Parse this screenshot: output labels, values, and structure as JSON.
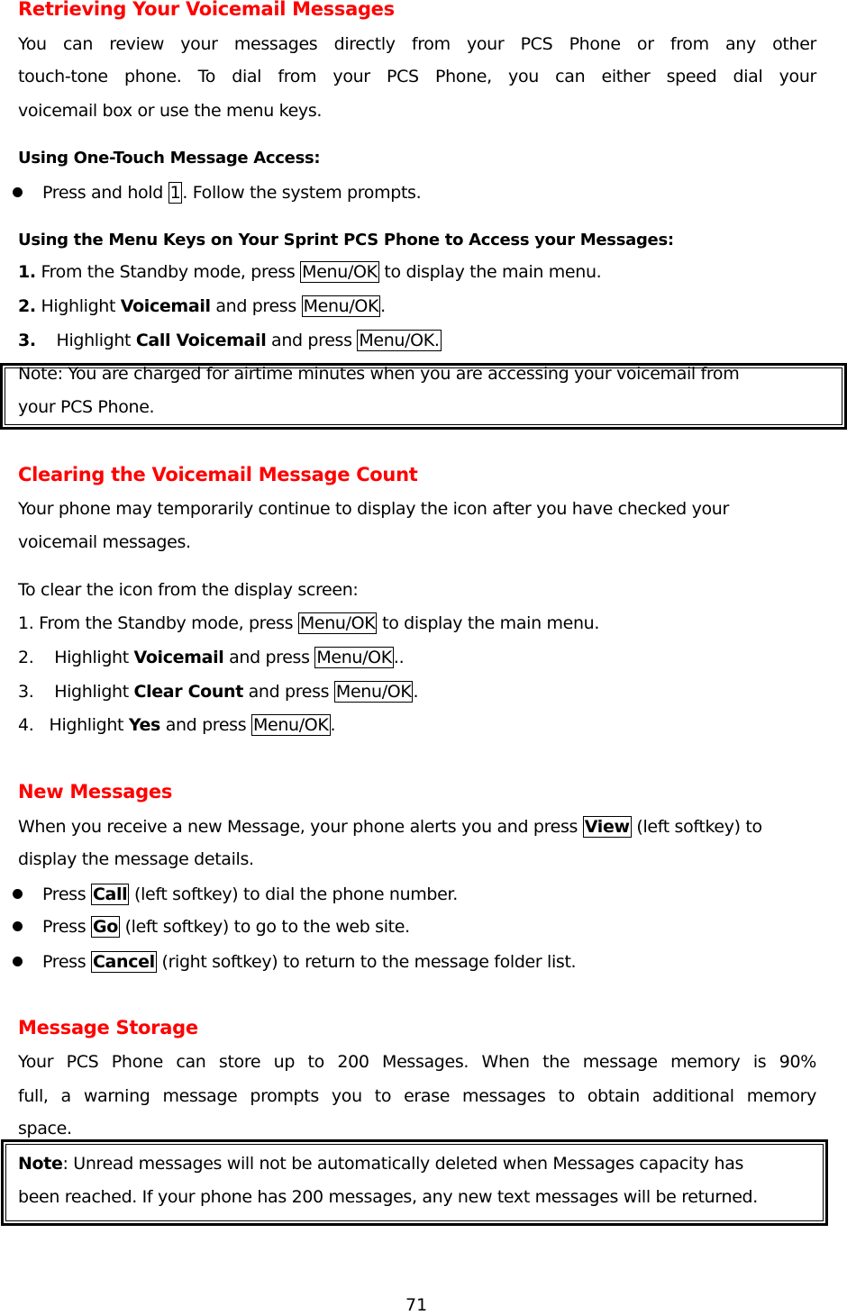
{
  "sections": {
    "retrieving": {
      "heading": "Retrieving Your Voicemail Messages",
      "intro_lines": [
        "You can review your messages directly from your PCS Phone or from any other",
        "touch-tone phone. To dial from your PCS Phone, you can either speed dial your",
        "voicemail box or use the menu keys."
      ],
      "one_touch_heading": "Using One-Touch Message Access:",
      "one_touch_bullet": {
        "prefix": "Press and hold ",
        "key": " 1",
        "suffix": ". Follow the system prompts."
      },
      "menu_keys_heading": "Using the Menu Keys on Your Sprint PCS Phone to Access your Messages:",
      "steps": [
        {
          "num": "1.",
          "pre": " From the Standby mode, press ",
          "bold": "",
          "mid": "",
          "key": "Menu/OK",
          "post": " to display the main menu."
        },
        {
          "num": "2.",
          "pre": " Highlight ",
          "bold": "Voicemail",
          "mid": " and press ",
          "key": "Menu/OK",
          "post": "."
        },
        {
          "num": "3.",
          "pre": "    Highlight ",
          "bold": "Call Voicemail",
          "mid": " and press ",
          "key": "Menu/OK.",
          "post": ""
        }
      ],
      "note_lines": [
        "Note: You are charged for airtime minutes when you are accessing your voicemail from",
        "your PCS Phone."
      ]
    },
    "clearing": {
      "heading": "Clearing the Voicemail Message Count",
      "intro_lines": [
        "Your phone may temporarily continue to display the icon after you have checked your",
        "voicemail messages."
      ],
      "instruction": "To clear the icon from the display screen:",
      "steps": [
        {
          "num": "1.",
          "pre": " From the Standby mode, press ",
          "bold": "",
          "mid": "",
          "key": "Menu/OK",
          "post": " to display the main menu."
        },
        {
          "num": "2.",
          "pre": "    Highlight ",
          "bold": "Voicemail",
          "mid": " and press ",
          "key": "Menu/OK",
          "post": ".."
        },
        {
          "num": "3.",
          "pre": "    Highlight ",
          "bold": "Clear Count",
          "mid": " and press ",
          "key": "Menu/OK",
          "post": "."
        },
        {
          "num": "4.",
          "pre": "   Highlight ",
          "bold": "Yes",
          "mid": " and press ",
          "key": "Menu/OK",
          "post": "."
        }
      ]
    },
    "new_messages": {
      "heading": "New Messages",
      "intro_line1_pre": "When you receive a new Message, your phone alerts you and press ",
      "intro_line1_key": "View",
      "intro_line1_post": " (left softkey) to",
      "intro_line2": "display the message details.",
      "bullets": [
        {
          "prefix": "Press ",
          "key": "Call",
          "suffix": " (left softkey) to dial the phone number."
        },
        {
          "prefix": "Press ",
          "key": "Go",
          "suffix": " (left softkey) to go to the web site."
        },
        {
          "prefix": "Press ",
          "key": "Cancel",
          "suffix": " (right softkey) to return to the message folder list."
        }
      ]
    },
    "storage": {
      "heading": "Message Storage",
      "intro_lines": [
        "Your PCS Phone can store up to 200 Messages. When the message memory is 90%",
        "full, a warning message prompts you to erase messages to obtain additional memory",
        "space."
      ],
      "note_label": "Note",
      "note_line1": ": Unread messages will not be automatically deleted when Messages capacity has",
      "note_line2": "been reached. If your phone has 200 messages, any new text messages will be returned."
    }
  },
  "footer": {
    "page_number": "71"
  },
  "colors": {
    "heading": "#ff0000",
    "text": "#000000"
  }
}
